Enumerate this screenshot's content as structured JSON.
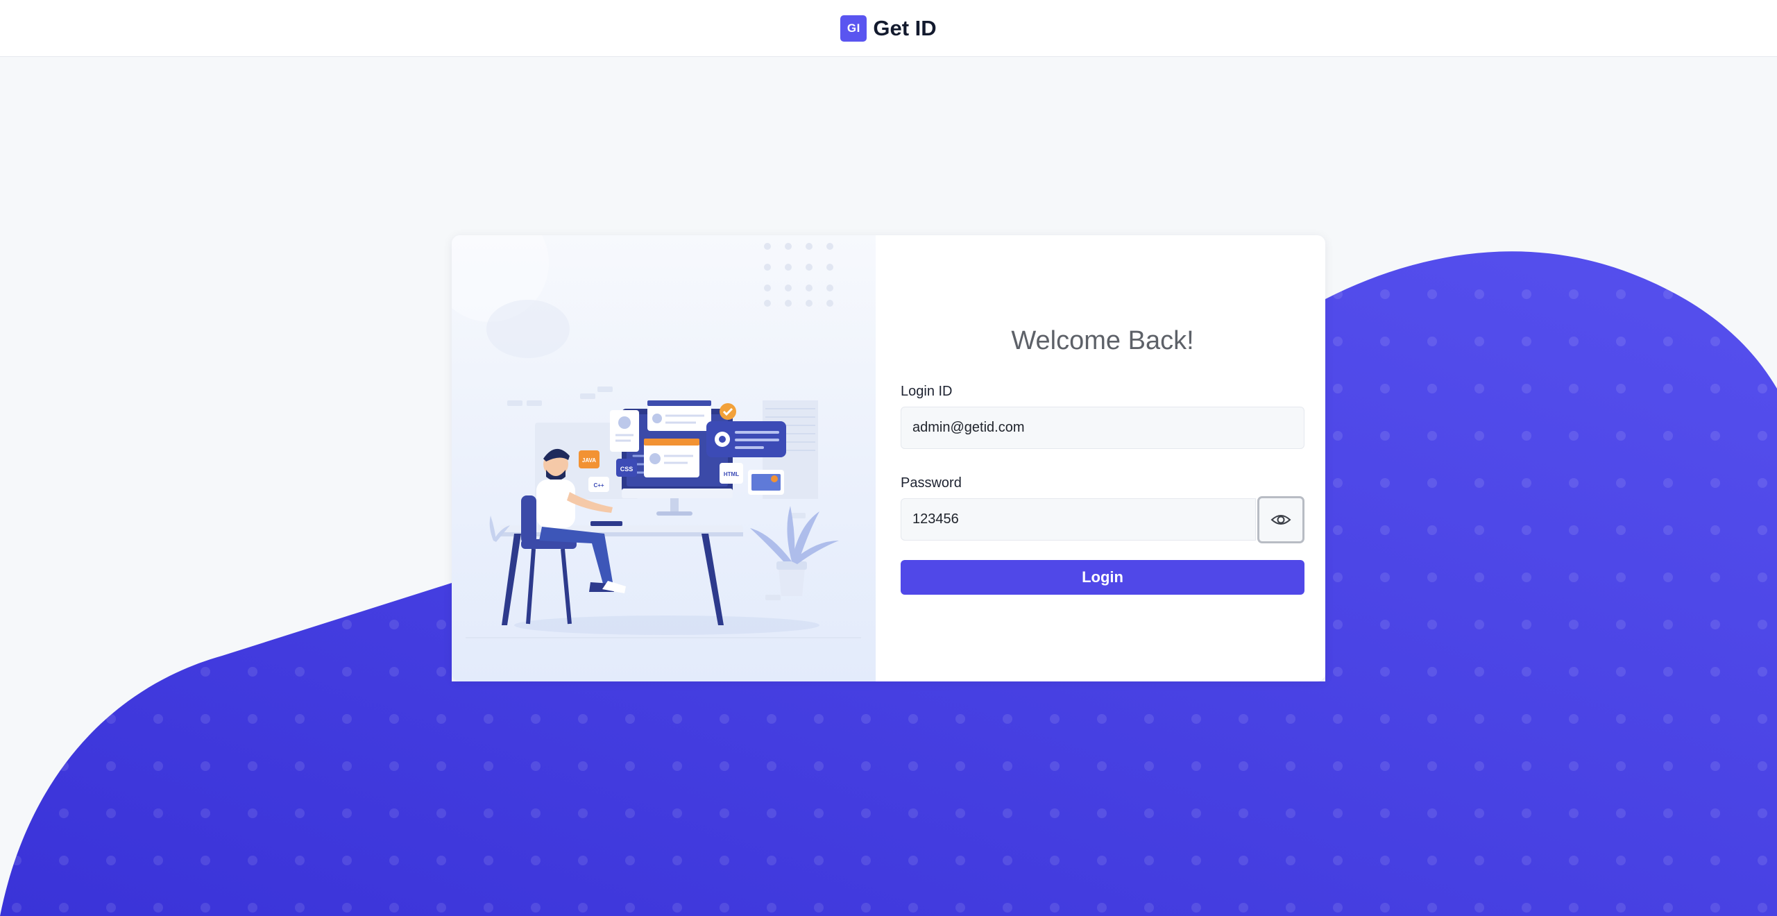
{
  "header": {
    "logo_text": "GI",
    "brand_name": "Get ID"
  },
  "illustration": {
    "code_tags": [
      "JAVA",
      "CSS",
      "C++",
      "HTML"
    ]
  },
  "form": {
    "title": "Welcome Back!",
    "login_id_label": "Login ID",
    "login_id_value": "admin@getid.com",
    "password_label": "Password",
    "password_value": "123456",
    "submit_label": "Login"
  },
  "colors": {
    "accent": "#5048e8",
    "wave": "#4a44e6",
    "page_bg": "#f6f8fa"
  },
  "icons": [
    "eye-icon"
  ]
}
